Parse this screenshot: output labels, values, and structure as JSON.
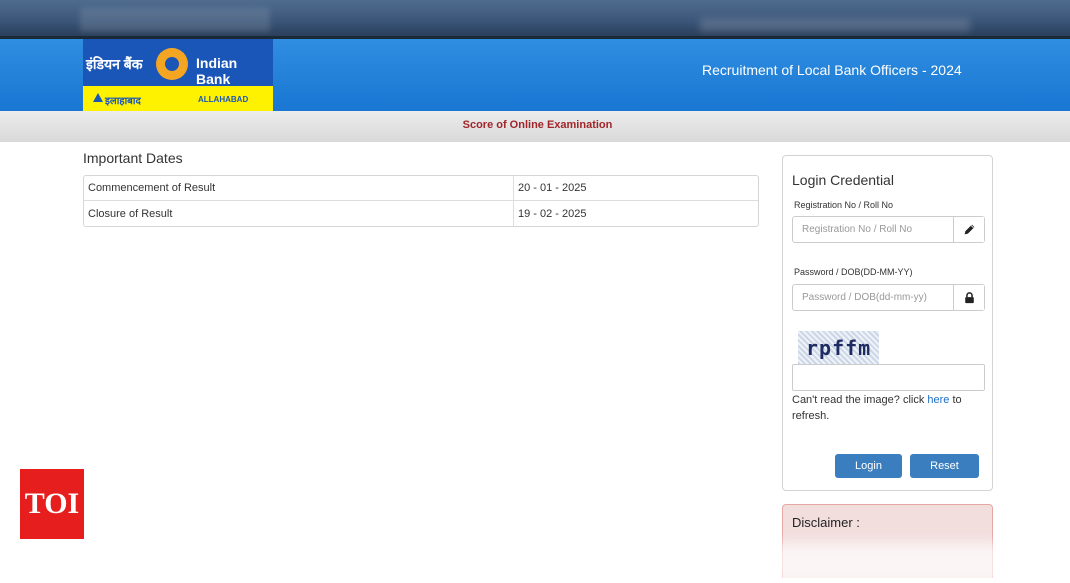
{
  "logo": {
    "hindi_name": "इंडियन बैंक",
    "english_name": "Indian Bank",
    "allahabad_hindi": "इलाहाबाद",
    "allahabad_english": "ALLAHABAD"
  },
  "header": {
    "title": "Recruitment of Local Bank Officers - 2024"
  },
  "subheader": {
    "title": "Score of Online Examination"
  },
  "important_dates": {
    "heading": "Important Dates",
    "rows": [
      {
        "label": "Commencement of Result",
        "value": "20 - 01 - 2025"
      },
      {
        "label": "Closure of Result",
        "value": "19 - 02 - 2025"
      }
    ]
  },
  "login": {
    "title": "Login Credential",
    "registration_label": "Registration No / Roll No",
    "registration_placeholder": "Registration No / Roll No",
    "password_label": "Password / DOB(DD-MM-YY)",
    "password_placeholder": "Password / DOB(dd-mm-yy)",
    "captcha_text": "rpffm",
    "captcha_help_prefix": "Can't read the image? click ",
    "captcha_help_link": "here",
    "captcha_help_suffix": " to refresh.",
    "login_label": "Login",
    "reset_label": "Reset",
    "icons": {
      "registration": "pencil-icon",
      "password": "lock-icon"
    }
  },
  "disclaimer": {
    "title": "Disclaimer :"
  },
  "watermark": {
    "text": "TOI"
  },
  "colors": {
    "header_blue": "#1976d2",
    "subheader_red": "#a1262a",
    "button_blue": "#3a7ebf",
    "disclaimer_bg": "#f3dede",
    "toi_red": "#e61e1e"
  }
}
